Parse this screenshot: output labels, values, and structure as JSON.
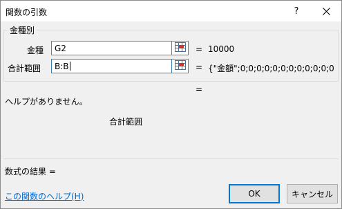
{
  "window": {
    "title": "関数の引数",
    "help_glyph": "?",
    "close_icon": "close-icon"
  },
  "group": {
    "label": "金種別",
    "args": [
      {
        "label": "金種",
        "value": "G2",
        "equals": "=",
        "result": "10000"
      },
      {
        "label": "合計範囲",
        "value": "B:B",
        "equals": "=",
        "result": "{\"金額\";0;0;0;0;0;0;0;0;0;0;0;0;0"
      }
    ]
  },
  "function_result_equals": "=",
  "help_text": "ヘルプがありません。",
  "current_arg_name": "合計範囲",
  "formula_result": {
    "label": "数式の結果 =",
    "value": ""
  },
  "help_link": "この関数のヘルプ(H)",
  "buttons": {
    "ok": "OK",
    "cancel": "キャンセル"
  },
  "colors": {
    "dialog_bg": "#f0f0f0",
    "link": "#0066cc",
    "default_button_border": "#0078d7"
  }
}
